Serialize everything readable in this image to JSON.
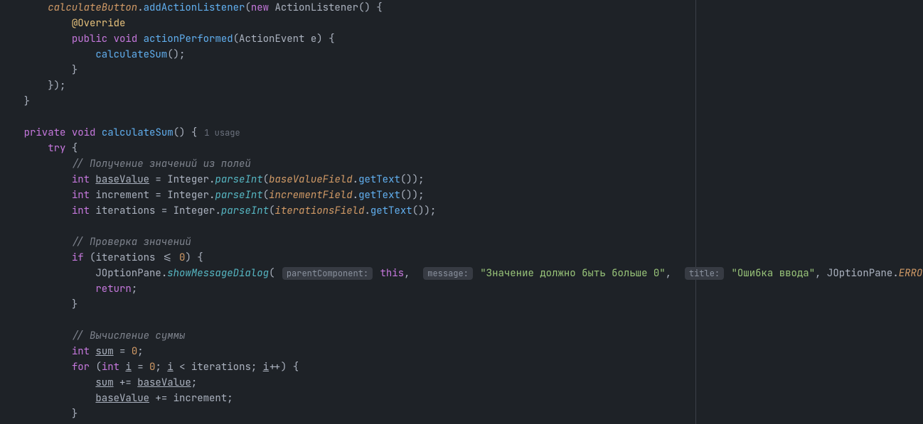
{
  "usageLabel": "1 usage",
  "hints": {
    "parentComponent": "parentComponent:",
    "message": "message:",
    "title": "title:"
  },
  "tokens": {
    "calculateButton": "calculateButton",
    "addActionListener": "addActionListener",
    "new": "new",
    "ActionListener": "ActionListener",
    "Override": "@Override",
    "public": "public",
    "void": "void",
    "actionPerformed": "actionPerformed",
    "ActionEvent": "ActionEvent",
    "e": "e",
    "calculateSum": "calculateSum",
    "private": "private",
    "try": "try",
    "comment1": "// Получение значений из полей",
    "int": "int",
    "baseValue": "baseValue",
    "Integer": "Integer",
    "parseInt": "parseInt",
    "baseValueField": "baseValueField",
    "getText": "getText",
    "increment": "increment",
    "incrementField": "incrementField",
    "iterations": "iterations",
    "iterationsField": "iterationsField",
    "comment2": "// Проверка значений",
    "if": "if",
    "lte0": "0",
    "JOptionPane": "JOptionPane",
    "showMessageDialog": "showMessageDialog",
    "this": "this",
    "msgStr": "\"Значение должно быть больше 0\"",
    "titleStr": "\"Ошибка ввода\"",
    "ERROR_MESSAGE": "ERROR_MESSAGE",
    "return": "return",
    "comment3": "// Вычисление суммы",
    "sum": "sum",
    "zero": "0",
    "for": "for",
    "i": "i"
  }
}
